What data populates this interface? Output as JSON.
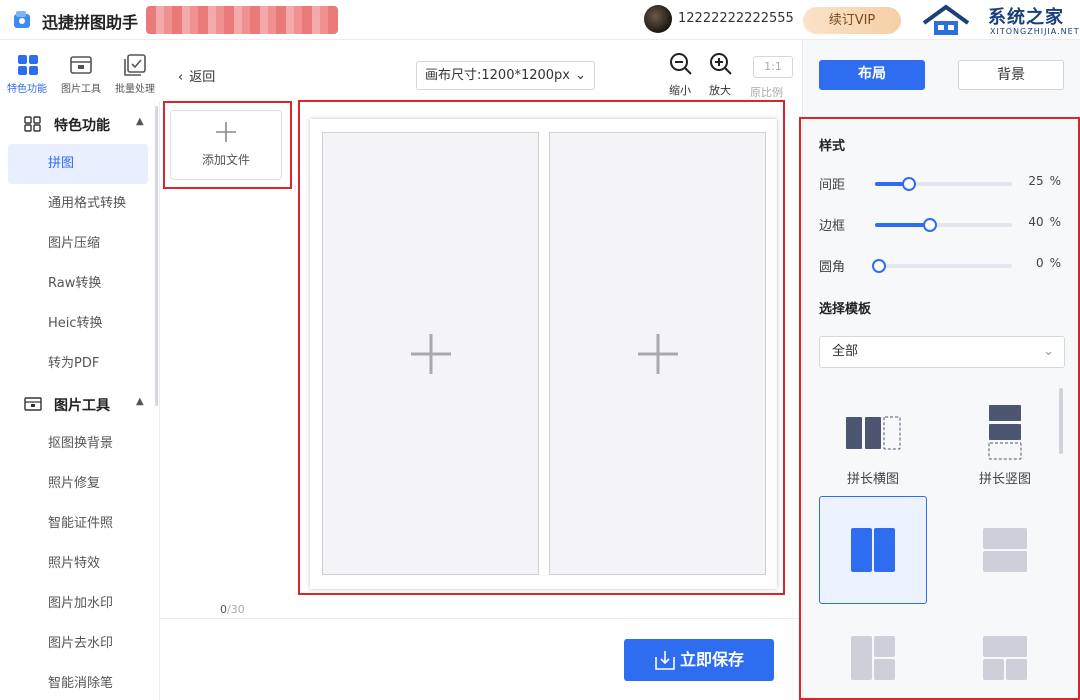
{
  "app": {
    "title": "迅捷拼图助手",
    "user_phone": "12222222222555",
    "vip_label": "续订VIP",
    "watermark_title": "系统之家",
    "watermark_sub": "XITONGZHIJIA.NET"
  },
  "tabs": [
    {
      "label": "特色功能",
      "icon": "grid-icon",
      "active": true
    },
    {
      "label": "图片工具",
      "icon": "image-tool-icon",
      "active": false
    },
    {
      "label": "批量处理",
      "icon": "batch-icon",
      "active": false
    }
  ],
  "sidebar": {
    "sections": [
      {
        "label": "特色功能",
        "icon": "grid-icon",
        "items": [
          "拼图",
          "通用格式转换",
          "图片压缩",
          "Raw转换",
          "Heic转换",
          "转为PDF"
        ]
      },
      {
        "label": "图片工具",
        "icon": "image-tool-icon",
        "items": [
          "抠图换背景",
          "照片修复",
          "智能证件照",
          "照片特效",
          "图片加水印",
          "图片去水印",
          "智能消除笔"
        ]
      }
    ],
    "active_item": "拼图"
  },
  "toolbar": {
    "back_label": "返回",
    "canvas_size": "画布尺寸:1200*1200px",
    "zoom_out_label": "缩小",
    "zoom_in_label": "放大",
    "ratio_value": "1:1",
    "ratio_label": "原比例"
  },
  "files": {
    "add_label": "添加文件",
    "count": "0",
    "total": "/30"
  },
  "save_label": "立即保存",
  "right_panel": {
    "tab_layout": "布局",
    "tab_background": "背景",
    "style_heading": "样式",
    "sliders": [
      {
        "label": "间距",
        "value": 25,
        "value_text": "25",
        "unit": "%"
      },
      {
        "label": "边框",
        "value": 40,
        "value_text": "40",
        "unit": "%"
      },
      {
        "label": "圆角",
        "value": 0,
        "value_text": "0",
        "unit": "%"
      }
    ],
    "template_heading": "选择模板",
    "template_filter": "全部",
    "templates": [
      {
        "label": "拼长横图"
      },
      {
        "label": "拼长竖图"
      }
    ]
  },
  "colors": {
    "accent": "#2e6cf0",
    "highlight_frame": "#d9262d",
    "template_dark": "#4c5670",
    "template_light": "#cdd0d8"
  }
}
